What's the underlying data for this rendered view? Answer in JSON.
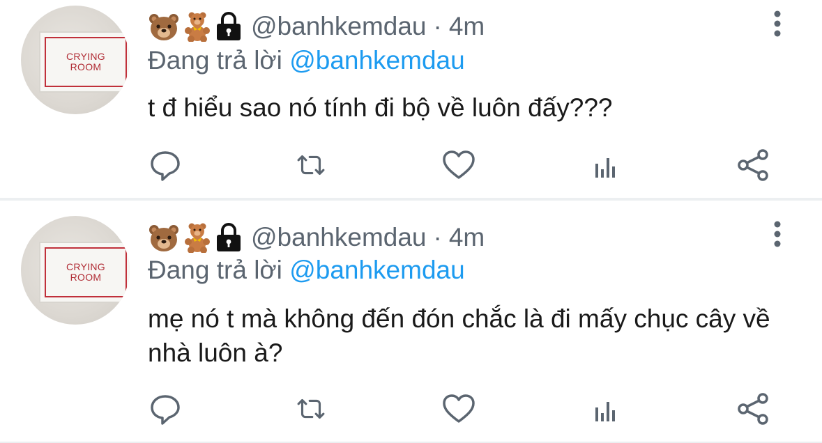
{
  "tweets": [
    {
      "avatar_sign": [
        "CRYING",
        "ROOM"
      ],
      "handle": "@banhkemdau",
      "time_separator": "·",
      "time": "4m",
      "replying_prefix": "Đang trả lời",
      "replying_to": "@banhkemdau",
      "text": "t đ hiểu sao nó tính đi bộ về luôn đấy???"
    },
    {
      "avatar_sign": [
        "CRYING",
        "ROOM"
      ],
      "handle": "@banhkemdau",
      "time_separator": "·",
      "time": "4m",
      "replying_prefix": "Đang trả lời",
      "replying_to": "@banhkemdau",
      "text": "mẹ nó t mà không đến đón chắc là đi mấy chục cây về nhà luôn à?"
    }
  ],
  "icons": {
    "name_emojis": [
      "bear-face-icon",
      "teddy-bear-icon",
      "lock-icon"
    ],
    "more": "more-vertical-icon",
    "actions": [
      "reply-icon",
      "retweet-icon",
      "like-icon",
      "analytics-icon",
      "share-icon"
    ]
  },
  "colors": {
    "text": "#1a1a1a",
    "secondary": "#5b6570",
    "link": "#1d9bf0",
    "icon": "#5b6570",
    "divider": "#eceff1"
  }
}
